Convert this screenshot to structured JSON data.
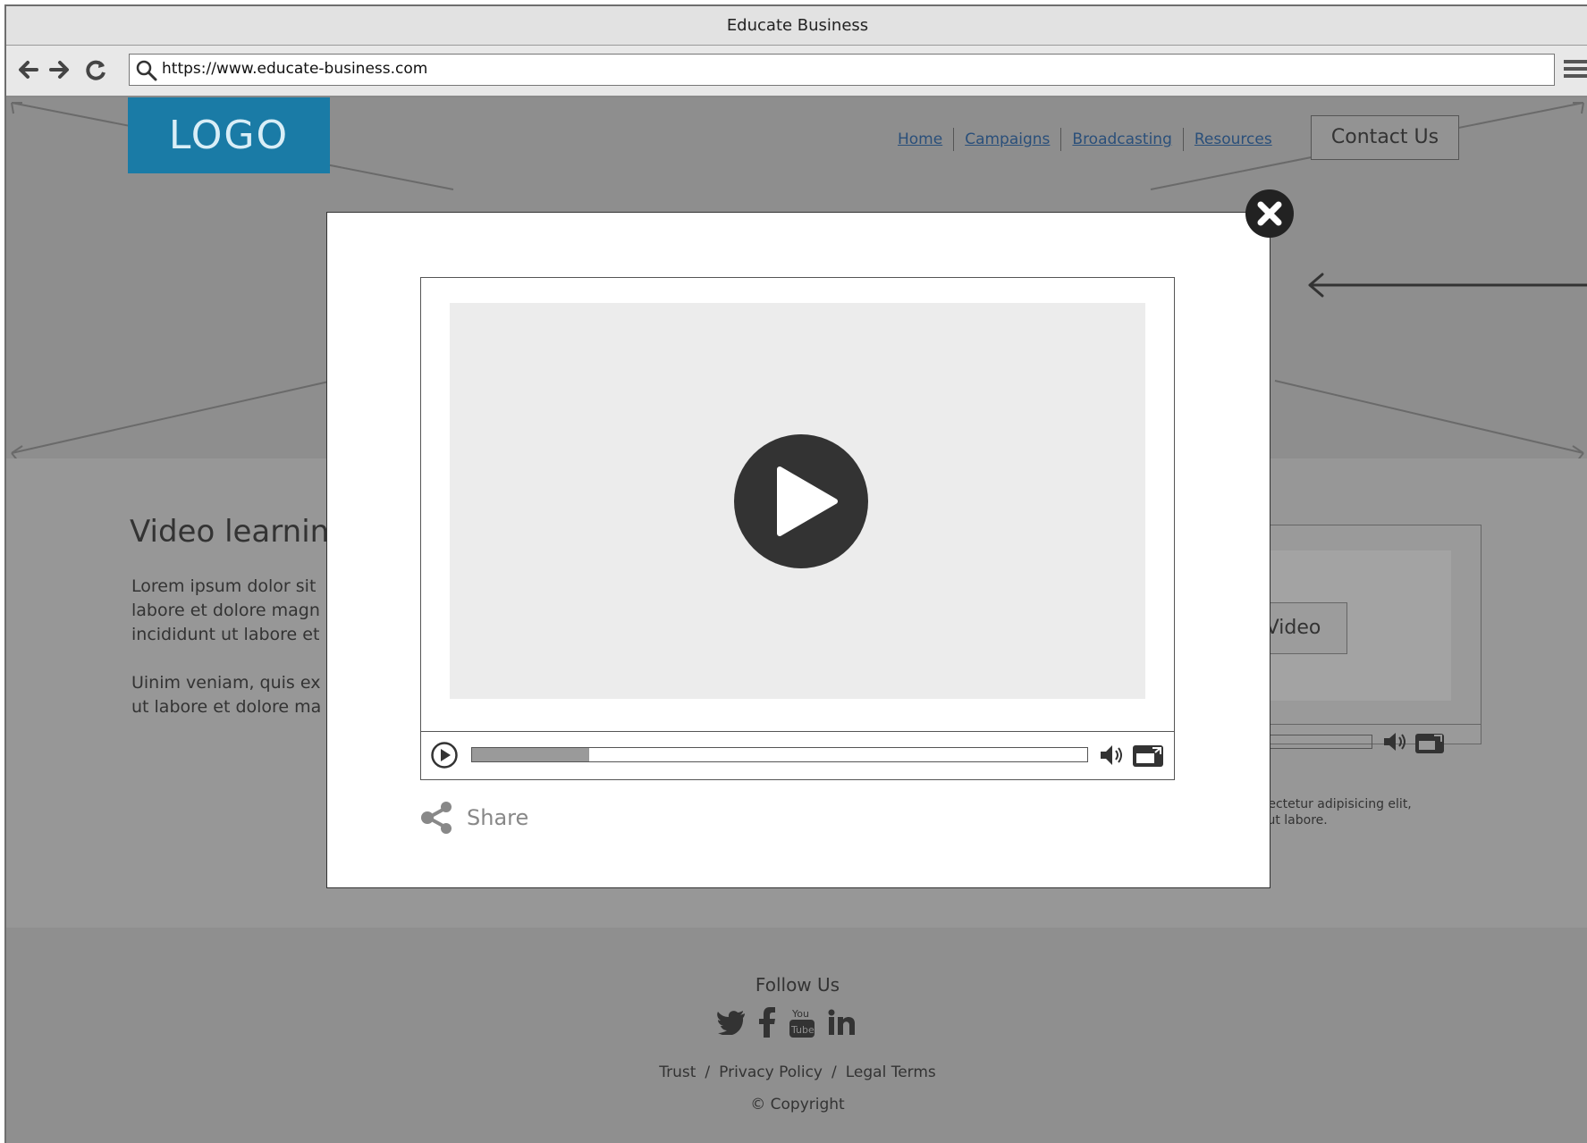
{
  "browser": {
    "title": "Educate Business",
    "url": "https://www.educate-business.com"
  },
  "header": {
    "logo": "LOGO",
    "nav": [
      "Home",
      "Campaigns",
      "Broadcasting",
      "Resources"
    ],
    "contact_label": "Contact Us"
  },
  "content": {
    "title": "Video learnin",
    "para1_lines": [
      "Lorem ipsum dolor sit",
      "labore et dolore magn",
      "incididunt ut labore et"
    ],
    "para2_lines": [
      "Uinim veniam, quis ex",
      "ut labore et dolore ma"
    ],
    "side_button_label": "ch Video",
    "caption_lines": [
      ", consectetur adipisicing elit,",
      "idunt ut labore."
    ]
  },
  "modal": {
    "share_label": "Share",
    "progress": 0.19
  },
  "footer": {
    "follow_label": "Follow Us",
    "social_icons": [
      "twitter-icon",
      "facebook-icon",
      "youtube-icon",
      "linkedin-icon"
    ],
    "links": [
      "Trust",
      "Privacy Policy",
      "Legal Terms"
    ],
    "copyright": "Copyright"
  },
  "colors": {
    "logo_bg": "#1a7ba6",
    "link": "#2a4f7a",
    "overlay": "#939393"
  }
}
